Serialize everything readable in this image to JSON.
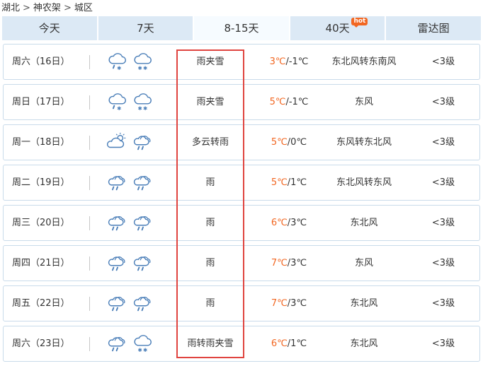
{
  "breadcrumb": [
    "湖北",
    "神农架",
    "城区"
  ],
  "breadcrumb_separator": ">",
  "tabs": [
    {
      "label": "今天",
      "active": false,
      "badge": ""
    },
    {
      "label": "7天",
      "active": false,
      "badge": ""
    },
    {
      "label": "8-15天",
      "active": true,
      "badge": ""
    },
    {
      "label": "40天",
      "active": false,
      "badge": "hot"
    },
    {
      "label": "雷达图",
      "active": false,
      "badge": ""
    }
  ],
  "colors": {
    "high_temp": "#f26722",
    "highlight": "#e0443f",
    "tab_bg": "#dce9f5",
    "row_border": "#c9dbea"
  },
  "days": [
    {
      "date": "周六（16日）",
      "icons": [
        "rain-snow-icon",
        "snow-icon"
      ],
      "desc": "雨夹雪",
      "high": "3℃",
      "low": "/-1℃",
      "wind": "东北风转东南风",
      "level": "<3级"
    },
    {
      "date": "周日（17日）",
      "icons": [
        "rain-snow-icon",
        "snow-icon"
      ],
      "desc": "雨夹雪",
      "high": "5℃",
      "low": "/-1℃",
      "wind": "东风",
      "level": "<3级"
    },
    {
      "date": "周一（18日）",
      "icons": [
        "partly-cloudy-icon",
        "rain-icon"
      ],
      "desc": "多云转雨",
      "high": "5℃",
      "low": "/0℃",
      "wind": "东风转东北风",
      "level": "<3级"
    },
    {
      "date": "周二（19日）",
      "icons": [
        "rain-icon",
        "rain-icon"
      ],
      "desc": "雨",
      "high": "5℃",
      "low": "/1℃",
      "wind": "东北风转东风",
      "level": "<3级"
    },
    {
      "date": "周三（20日）",
      "icons": [
        "rain-icon",
        "rain-icon"
      ],
      "desc": "雨",
      "high": "6℃",
      "low": "/3℃",
      "wind": "东北风",
      "level": "<3级"
    },
    {
      "date": "周四（21日）",
      "icons": [
        "rain-icon",
        "rain-icon"
      ],
      "desc": "雨",
      "high": "7℃",
      "low": "/3℃",
      "wind": "东风",
      "level": "<3级"
    },
    {
      "date": "周五（22日）",
      "icons": [
        "rain-icon",
        "rain-icon"
      ],
      "desc": "雨",
      "high": "7℃",
      "low": "/3℃",
      "wind": "东北风",
      "level": "<3级"
    },
    {
      "date": "周六（23日）",
      "icons": [
        "rain-icon",
        "snow-icon"
      ],
      "desc": "雨转雨夹雪",
      "high": "6℃",
      "low": "/1℃",
      "wind": "东北风",
      "level": "<3级"
    }
  ]
}
